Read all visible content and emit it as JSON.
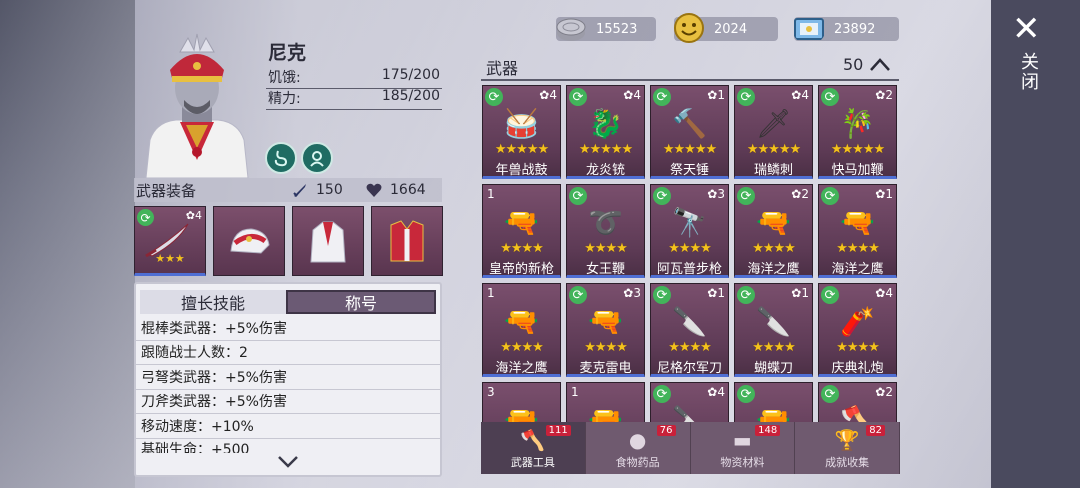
{
  "character": {
    "name": "尼克",
    "hunger_label": "饥饿:",
    "hunger_value": "175/200",
    "stamina_label": "精力:",
    "stamina_value": "185/200"
  },
  "equipment": {
    "title": "武器装备",
    "attack": "150",
    "health": "1664",
    "slot1_level": "4"
  },
  "skills": {
    "tab_skills": "擅长技能",
    "tab_title": "称号",
    "lines": [
      "棍棒类武器：+5%伤害",
      "跟随战士人数：2",
      "弓弩类武器：+5%伤害",
      "刀斧类武器：+5%伤害",
      "移动速度：+10%",
      "基础生命：+500"
    ]
  },
  "currencies": {
    "silver": "15523",
    "gold": "2024",
    "tickets": "23892"
  },
  "weapons": {
    "title": "武器",
    "count": "50",
    "items": [
      {
        "name": "年兽战鼓",
        "level": "4"
      },
      {
        "name": "龙炎铳",
        "level": "4"
      },
      {
        "name": "祭天锤",
        "level": "1"
      },
      {
        "name": "瑞鳞刺",
        "level": "4"
      },
      {
        "name": "快马加鞭",
        "level": "2"
      },
      {
        "name": "皇帝的新枪",
        "level": "1"
      },
      {
        "name": "女王鞭",
        "level": ""
      },
      {
        "name": "阿瓦普步枪",
        "level": "3"
      },
      {
        "name": "海洋之鹰",
        "level": "2"
      },
      {
        "name": "海洋之鹰",
        "level": "1"
      },
      {
        "name": "海洋之鹰",
        "level": "1"
      },
      {
        "name": "麦克雷电",
        "level": "3"
      },
      {
        "name": "尼格尔军刀",
        "level": "1"
      },
      {
        "name": "蝴蝶刀",
        "level": "1"
      },
      {
        "name": "庆典礼炮",
        "level": "4"
      },
      {
        "name": "",
        "level": "3"
      },
      {
        "name": "",
        "level": "1"
      },
      {
        "name": "",
        "level": "4"
      },
      {
        "name": "",
        "level": ""
      },
      {
        "name": "",
        "level": "2"
      }
    ]
  },
  "nav": {
    "weapons_label": "武器工具",
    "weapons_badge": "111",
    "food_label": "食物药品",
    "food_badge": "76",
    "material_label": "物资材料",
    "material_badge": "148",
    "achieve_label": "成就收集",
    "achieve_badge": "82"
  },
  "close_label": "关闭"
}
